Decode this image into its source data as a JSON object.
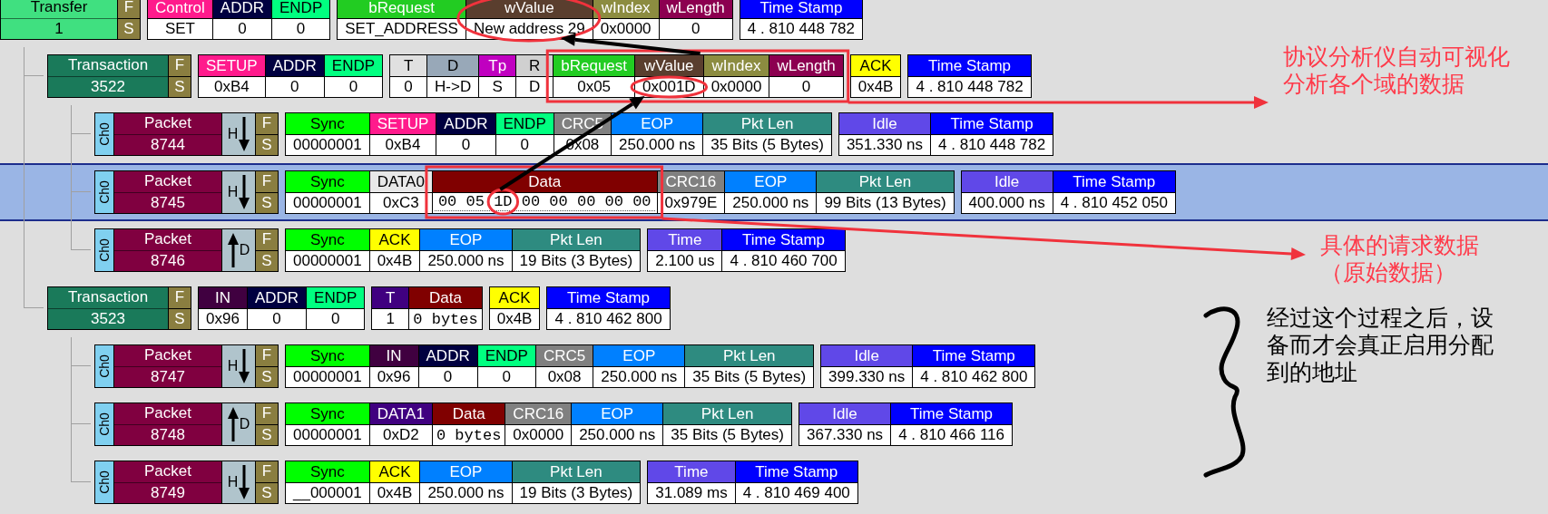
{
  "trace": {
    "kind": "transfer",
    "label": "Transfer",
    "number": "1",
    "color": "#40e080",
    "flags": [
      "F",
      "S"
    ],
    "selected": false,
    "groups": [
      {
        "cells": [
          {
            "label": "Control",
            "value": "SET",
            "color": "#ff1a8c",
            "kind": "text"
          },
          {
            "label": "ADDR",
            "value": "0",
            "color": "#000040",
            "kind": "text"
          },
          {
            "label": "ENDP",
            "value": "0",
            "color": "#00ff80",
            "kind": "text"
          }
        ]
      },
      {
        "cells": [
          {
            "label": "bRequest",
            "value": "SET_ADDRESS",
            "color": "#22cc22",
            "kind": "text"
          },
          {
            "label": "wValue",
            "value": "New address 29",
            "color": "#5a3e2e",
            "kind": "text"
          },
          {
            "label": "wIndex",
            "value": "0x0000",
            "color": "#8c8c40",
            "kind": "text"
          },
          {
            "label": "wLength",
            "value": "0",
            "color": "#8c0050",
            "kind": "text"
          }
        ]
      },
      {
        "cells": [
          {
            "label": "Time Stamp",
            "value": "4 . 810 448 782",
            "color": "#0000ff",
            "kind": "text"
          }
        ]
      }
    ],
    "children": [
      {
        "kind": "transaction",
        "label": "Transaction",
        "number": "3522",
        "color": "#1a7a5a",
        "flags": [
          "F",
          "S"
        ],
        "selected": false,
        "groups": [
          {
            "cells": [
              {
                "label": "SETUP",
                "value": "0xB4",
                "color": "#ff1a8c",
                "kind": "text"
              },
              {
                "label": "ADDR",
                "value": "0",
                "color": "#000040",
                "kind": "text"
              },
              {
                "label": "ENDP",
                "value": "0",
                "color": "#00ff80",
                "kind": "text"
              }
            ]
          },
          {
            "cells": [
              {
                "label": "T",
                "value": "0",
                "color": "#e0e0e0",
                "kind": "text"
              },
              {
                "label": "D",
                "value": "H->D",
                "color": "#98a8b8",
                "kind": "text"
              },
              {
                "label": "Tp",
                "value": "S",
                "color": "#c000c0",
                "kind": "text"
              },
              {
                "label": "R",
                "value": "D",
                "color": "#d0d0d0",
                "kind": "text"
              },
              {
                "label": "bRequest",
                "value": "0x05",
                "color": "#22cc22",
                "kind": "text"
              },
              {
                "label": "wValue",
                "value": "0x001D",
                "color": "#5a3e2e",
                "kind": "text"
              },
              {
                "label": "wIndex",
                "value": "0x0000",
                "color": "#8c8c40",
                "kind": "text"
              },
              {
                "label": "wLength",
                "value": "0",
                "color": "#8c0050",
                "kind": "text"
              }
            ]
          },
          {
            "cells": [
              {
                "label": "ACK",
                "value": "0x4B",
                "color": "#ffff00",
                "kind": "text"
              }
            ]
          },
          {
            "cells": [
              {
                "label": "Time Stamp",
                "value": "4 . 810 448 782",
                "color": "#0000ff",
                "kind": "text"
              }
            ]
          }
        ],
        "children": [
          {
            "kind": "packet",
            "channel": "Ch0",
            "label": "Packet",
            "number": "8744",
            "color": "#800040",
            "endpoint": "H",
            "up": false,
            "flags": [
              "F",
              "S"
            ],
            "selected": false,
            "groups": [
              {
                "cells": [
                  {
                    "label": "Sync",
                    "value": "00000001",
                    "color": "#00ff00",
                    "kind": "text"
                  },
                  {
                    "label": "SETUP",
                    "value": "0xB4",
                    "color": "#ff1a8c",
                    "kind": "text"
                  },
                  {
                    "label": "ADDR",
                    "value": "0",
                    "color": "#000040",
                    "kind": "text"
                  },
                  {
                    "label": "ENDP",
                    "value": "0",
                    "color": "#00ff80",
                    "kind": "text"
                  },
                  {
                    "label": "CRC5",
                    "value": "0x08",
                    "color": "#808080",
                    "kind": "text"
                  },
                  {
                    "label": "EOP",
                    "value": "250.000 ns",
                    "color": "#0080ff",
                    "kind": "text"
                  },
                  {
                    "label": "Pkt Len",
                    "value": "35 Bits (5 Bytes)",
                    "color": "#2e8b80",
                    "kind": "text"
                  }
                ]
              },
              {
                "cells": [
                  {
                    "label": "Idle",
                    "value": "351.330 ns",
                    "color": "#6048e8",
                    "kind": "text"
                  },
                  {
                    "label": "Time Stamp",
                    "value": "4 . 810 448 782",
                    "color": "#0000ff",
                    "kind": "text"
                  }
                ]
              }
            ]
          },
          {
            "kind": "packet",
            "channel": "Ch0",
            "label": "Packet",
            "number": "8745",
            "color": "#800040",
            "endpoint": "H",
            "up": false,
            "flags": [
              "F",
              "S"
            ],
            "selected": true,
            "groups": [
              {
                "cells": [
                  {
                    "label": "Sync",
                    "value": "00000001",
                    "color": "#00ff00",
                    "kind": "text"
                  },
                  {
                    "label": "DATA0",
                    "value": "0xC3",
                    "color": "#e8e8e8",
                    "kind": "text"
                  },
                  {
                    "label": "Data",
                    "value": "00 05 1D 00 00 00 00 00",
                    "color": "#800000",
                    "kind": "bytes"
                  },
                  {
                    "label": "CRC16",
                    "value": "0x979E",
                    "color": "#808080",
                    "kind": "text"
                  },
                  {
                    "label": "EOP",
                    "value": "250.000 ns",
                    "color": "#0080ff",
                    "kind": "text"
                  },
                  {
                    "label": "Pkt Len",
                    "value": "99 Bits (13 Bytes)",
                    "color": "#2e8b80",
                    "kind": "text"
                  }
                ]
              },
              {
                "cells": [
                  {
                    "label": "Idle",
                    "value": "400.000 ns",
                    "color": "#6048e8",
                    "kind": "text"
                  },
                  {
                    "label": "Time Stamp",
                    "value": "4 . 810 452 050",
                    "color": "#0000ff",
                    "kind": "text"
                  }
                ]
              }
            ]
          },
          {
            "kind": "packet",
            "channel": "Ch0",
            "label": "Packet",
            "number": "8746",
            "color": "#800040",
            "endpoint": "D",
            "up": true,
            "flags": [
              "F",
              "S"
            ],
            "selected": false,
            "groups": [
              {
                "cells": [
                  {
                    "label": "Sync",
                    "value": "00000001",
                    "color": "#00ff00",
                    "kind": "text"
                  },
                  {
                    "label": "ACK",
                    "value": "0x4B",
                    "color": "#ffff00",
                    "kind": "text"
                  },
                  {
                    "label": "EOP",
                    "value": "250.000 ns",
                    "color": "#0080ff",
                    "kind": "text"
                  },
                  {
                    "label": "Pkt Len",
                    "value": "19 Bits (3 Bytes)",
                    "color": "#2e8b80",
                    "kind": "text"
                  }
                ]
              },
              {
                "cells": [
                  {
                    "label": "Time",
                    "value": "2.100 us",
                    "color": "#6048e8",
                    "kind": "text"
                  },
                  {
                    "label": "Time Stamp",
                    "value": "4 . 810 460 700",
                    "color": "#0000ff",
                    "kind": "text"
                  }
                ]
              }
            ]
          }
        ]
      },
      {
        "kind": "transaction",
        "label": "Transaction",
        "number": "3523",
        "color": "#1a7a5a",
        "flags": [
          "F",
          "S"
        ],
        "selected": false,
        "groups": [
          {
            "cells": [
              {
                "label": "IN",
                "value": "0x96",
                "color": "#400040",
                "kind": "text"
              },
              {
                "label": "ADDR",
                "value": "0",
                "color": "#000040",
                "kind": "text"
              },
              {
                "label": "ENDP",
                "value": "0",
                "color": "#00ff80",
                "kind": "text"
              }
            ]
          },
          {
            "cells": [
              {
                "label": "T",
                "value": "1",
                "color": "#400080",
                "kind": "text"
              },
              {
                "label": "Data",
                "value": "0 bytes",
                "color": "#800000",
                "kind": "mono"
              }
            ]
          },
          {
            "cells": [
              {
                "label": "ACK",
                "value": "0x4B",
                "color": "#ffff00",
                "kind": "text"
              }
            ]
          },
          {
            "cells": [
              {
                "label": "Time Stamp",
                "value": "4 . 810 462 800",
                "color": "#0000ff",
                "kind": "text"
              }
            ]
          }
        ],
        "children": [
          {
            "kind": "packet",
            "channel": "Ch0",
            "label": "Packet",
            "number": "8747",
            "color": "#800040",
            "endpoint": "H",
            "up": false,
            "flags": [
              "F",
              "S"
            ],
            "selected": false,
            "groups": [
              {
                "cells": [
                  {
                    "label": "Sync",
                    "value": "00000001",
                    "color": "#00ff00",
                    "kind": "text"
                  },
                  {
                    "label": "IN",
                    "value": "0x96",
                    "color": "#400040",
                    "kind": "text"
                  },
                  {
                    "label": "ADDR",
                    "value": "0",
                    "color": "#000040",
                    "kind": "text"
                  },
                  {
                    "label": "ENDP",
                    "value": "0",
                    "color": "#00ff80",
                    "kind": "text"
                  },
                  {
                    "label": "CRC5",
                    "value": "0x08",
                    "color": "#808080",
                    "kind": "text"
                  },
                  {
                    "label": "EOP",
                    "value": "250.000 ns",
                    "color": "#0080ff",
                    "kind": "text"
                  },
                  {
                    "label": "Pkt Len",
                    "value": "35 Bits (5 Bytes)",
                    "color": "#2e8b80",
                    "kind": "text"
                  }
                ]
              },
              {
                "cells": [
                  {
                    "label": "Idle",
                    "value": "399.330 ns",
                    "color": "#6048e8",
                    "kind": "text"
                  },
                  {
                    "label": "Time Stamp",
                    "value": "4 . 810 462 800",
                    "color": "#0000ff",
                    "kind": "text"
                  }
                ]
              }
            ]
          },
          {
            "kind": "packet",
            "channel": "Ch0",
            "label": "Packet",
            "number": "8748",
            "color": "#800040",
            "endpoint": "D",
            "up": true,
            "flags": [
              "F",
              "S"
            ],
            "selected": false,
            "groups": [
              {
                "cells": [
                  {
                    "label": "Sync",
                    "value": "00000001",
                    "color": "#00ff00",
                    "kind": "text"
                  },
                  {
                    "label": "DATA1",
                    "value": "0xD2",
                    "color": "#400080",
                    "kind": "text"
                  },
                  {
                    "label": "Data",
                    "value": "0 bytes",
                    "color": "#800000",
                    "kind": "mono"
                  },
                  {
                    "label": "CRC16",
                    "value": "0x0000",
                    "color": "#808080",
                    "kind": "text"
                  },
                  {
                    "label": "EOP",
                    "value": "250.000 ns",
                    "color": "#0080ff",
                    "kind": "text"
                  },
                  {
                    "label": "Pkt Len",
                    "value": "35 Bits (5 Bytes)",
                    "color": "#2e8b80",
                    "kind": "text"
                  }
                ]
              },
              {
                "cells": [
                  {
                    "label": "Idle",
                    "value": "367.330 ns",
                    "color": "#6048e8",
                    "kind": "text"
                  },
                  {
                    "label": "Time Stamp",
                    "value": "4 . 810 466 116",
                    "color": "#0000ff",
                    "kind": "text"
                  }
                ]
              }
            ]
          },
          {
            "kind": "packet",
            "channel": "Ch0",
            "label": "Packet",
            "number": "8749",
            "color": "#800040",
            "endpoint": "H",
            "up": false,
            "flags": [
              "F",
              "S"
            ],
            "selected": false,
            "groups": [
              {
                "cells": [
                  {
                    "label": "Sync",
                    "value": "__000001",
                    "color": "#00ff00",
                    "kind": "text"
                  },
                  {
                    "label": "ACK",
                    "value": "0x4B",
                    "color": "#ffff00",
                    "kind": "text"
                  },
                  {
                    "label": "EOP",
                    "value": "250.000 ns",
                    "color": "#0080ff",
                    "kind": "text"
                  },
                  {
                    "label": "Pkt Len",
                    "value": "19 Bits (3 Bytes)",
                    "color": "#2e8b80",
                    "kind": "text"
                  }
                ]
              },
              {
                "cells": [
                  {
                    "label": "Time",
                    "value": "31.089 ms",
                    "color": "#6048e8",
                    "kind": "text"
                  },
                  {
                    "label": "Time Stamp",
                    "value": "4 . 810 469 400",
                    "color": "#0000ff",
                    "kind": "text"
                  }
                ]
              }
            ]
          }
        ]
      }
    ]
  },
  "callouts": [
    {
      "kind": "arrow",
      "lines": [
        "协议分析仪自动可视化",
        "分析各个域的数据"
      ]
    },
    {
      "kind": "arrow",
      "lines": [
        "具体的请求数据",
        "（原始数据）"
      ]
    },
    {
      "kind": "brace",
      "lines": [
        "经过这个过程之后，设",
        "备而才会真正启用分配",
        "到的地址"
      ]
    }
  ]
}
